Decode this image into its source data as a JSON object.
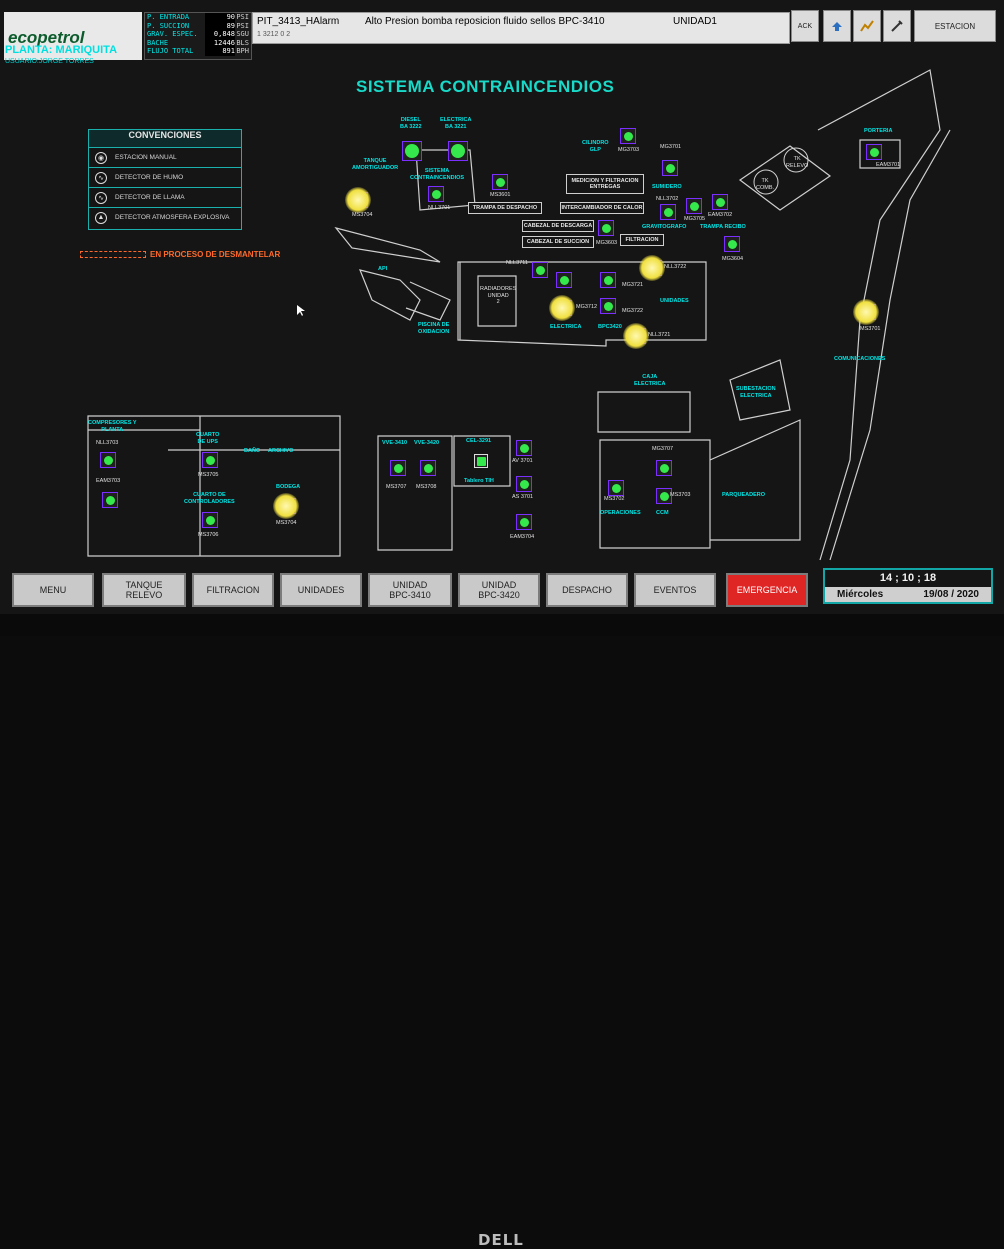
{
  "header": {
    "logo_text": "ecopetrol",
    "planta": "PLANTA: MARIQUITA",
    "usuario": "USUARIO:JORGE TORRES",
    "measurements": [
      {
        "label": "P. ENTRADA",
        "value": "90",
        "unit": "PSI"
      },
      {
        "label": "P. SUCCION",
        "value": "89",
        "unit": "PSI"
      },
      {
        "label": "GRAV. ESPEC.",
        "value": "0,848",
        "unit": "SGU"
      },
      {
        "label": "BACHE",
        "value": "12446",
        "unit": "BLS"
      },
      {
        "label": "FLUJO TOTAL",
        "value": "891",
        "unit": "BPH"
      }
    ]
  },
  "alarm": {
    "tag": "PIT_3413_HAlarm",
    "message": "Alto Presion bomba reposicion fluido sellos BPC-3410",
    "unit": "UNIDAD1",
    "counts": "1     3212     0     2"
  },
  "toolbar": {
    "ack": "ACK",
    "estacion": "ESTACION"
  },
  "title": "SISTEMA CONTRAINCENDIOS",
  "conventions": {
    "header": "CONVENCIONES",
    "items": [
      {
        "label": "ESTACION MANUAL",
        "icon": "manual-station-icon"
      },
      {
        "label": "DETECTOR DE HUMO",
        "icon": "smoke-detector-icon"
      },
      {
        "label": "DETECTOR DE LLAMA",
        "icon": "flame-detector-icon"
      },
      {
        "label": "DETECTOR ATMOSFERA EXPLOSIVA",
        "icon": "explosive-atmosphere-icon"
      }
    ]
  },
  "desmantelar": "EN PROCESO DE DESMANTELAR",
  "map_labels": {
    "diesel": "DIESEL\nBA 3222",
    "electrica": "ELECTRICA\nBA 3221",
    "tanque_amort": "TANQUE\nAMORTIGUADOR",
    "sistema_ci": "SISTEMA\nCONTRAINCENDIOS",
    "cilindro": "CILINDRO\nGLP",
    "medicion": "MEDICION Y FILTRACION\nENTREGAS",
    "trampa_despacho": "TRAMPA DE DESPACHO",
    "intercambiador": "INTERCAMBIADOR DE CALOR",
    "cabezal_descarga": "CABEZAL DE DESCARGA",
    "cabezal_succion": "CABEZAL DE SUCCION",
    "filtracion": "FILTRACION",
    "sumidero": "SUMIDERO",
    "gravitografo": "GRAVITOGRAFO",
    "trampa_recibo": "TRAMPA RECIBO",
    "tk_comb": "TK\nCOMB.",
    "tk_relevo": "TK\nRELEVO",
    "porteria": "PORTERIA",
    "radiadores": "RADIADORES\nUNIDAD\n2",
    "api": "API",
    "piscina": "PISCINA DE\nOXIDACION",
    "electrica_lbl": "ELECTRICA",
    "bpc3420": "BPC3420",
    "unidades": "UNIDADES",
    "caja_electrica": "CAJA\nELECTRICA",
    "comunicaciones": "COMUNICACIONES",
    "subestacion": "SUBESTACION\nELECTRICA",
    "parqueadero": "PARQUEADERO",
    "operaciones": "OPERACIONES",
    "ccm": "CCM",
    "compresores": "COMPRESORES Y\nPLANTA",
    "cuarto_ups": "CUARTO\nDE UPS",
    "bano": "BAÑO",
    "archivo": "ARCHIVO",
    "cuarto_control": "CUARTO DE\nCONTROLADORES",
    "bodega": "BODEGA",
    "vve3410": "VVE-3410",
    "vve3420": "VVE-3420",
    "cel3291": "CEL-3291",
    "tablero": "Tablero TIH"
  },
  "devices": [
    {
      "tag": "MS3704"
    },
    {
      "tag": "NLL3701"
    },
    {
      "tag": "MS3601"
    },
    {
      "tag": "MG3703"
    },
    {
      "tag": "MG3701"
    },
    {
      "tag": "NLL3702"
    },
    {
      "tag": "MG3705"
    },
    {
      "tag": "EAM3702"
    },
    {
      "tag": "MG3603"
    },
    {
      "tag": "MG3604"
    },
    {
      "tag": "NLL3711"
    },
    {
      "tag": "MS3711"
    },
    {
      "tag": "MG3721"
    },
    {
      "tag": "MG3712"
    },
    {
      "tag": "MG3722"
    },
    {
      "tag": "NLL3722"
    },
    {
      "tag": "NLL3721"
    },
    {
      "tag": "EAM3701"
    },
    {
      "tag": "MS3701"
    },
    {
      "tag": "NLL3703"
    },
    {
      "tag": "EAM3703"
    },
    {
      "tag": "MS3705"
    },
    {
      "tag": "MS3706"
    },
    {
      "tag": "MS3704"
    },
    {
      "tag": "MS3707"
    },
    {
      "tag": "MS3708"
    },
    {
      "tag": "AV 3701"
    },
    {
      "tag": "AS 3701"
    },
    {
      "tag": "EAM3704"
    },
    {
      "tag": "MG3707"
    },
    {
      "tag": "MS3702"
    },
    {
      "tag": "MS3703"
    }
  ],
  "nav": {
    "menu": "MENU",
    "tanque_relevo": "TANQUE\nRELEVO",
    "filtracion": "FILTRACION",
    "unidades": "UNIDADES",
    "unidad_3410": "UNIDAD\nBPC-3410",
    "unidad_3420": "UNIDAD\nBPC-3420",
    "despacho": "DESPACHO",
    "eventos": "EVENTOS",
    "emergencia": "EMERGENCIA"
  },
  "clock": {
    "time": "14 ; 10 ; 18",
    "day": "Miércoles",
    "date": "19/08 / 2020"
  },
  "brand_footer": "DELL",
  "colors": {
    "accent": "#19d9c8",
    "alert": "#e02525",
    "device_ok": "#35e84c",
    "device_alarm": "#f0e040"
  }
}
